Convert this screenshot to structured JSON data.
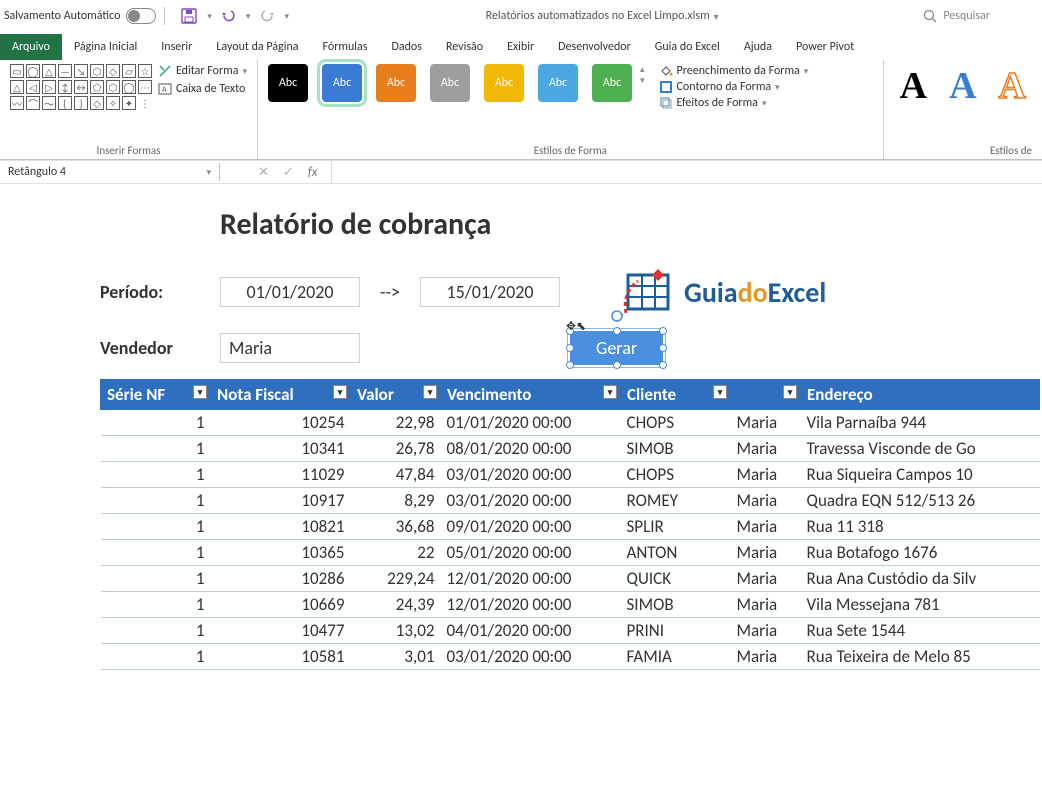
{
  "titlebar": {
    "autosave_label": "Salvamento Automático",
    "file_title": "Relatórios automatizados no Excel Limpo.xlsm",
    "search_placeholder": "Pesquisar"
  },
  "tabs": [
    "Arquivo",
    "Página Inicial",
    "Inserir",
    "Layout da Página",
    "Fórmulas",
    "Dados",
    "Revisão",
    "Exibir",
    "Desenvolvedor",
    "Guia do Excel",
    "Ajuda",
    "Power Pivot"
  ],
  "ribbon": {
    "shapes": {
      "edit_shape": "Editar Forma",
      "text_box": "Caixa de Texto",
      "group_label": "Inserir Formas"
    },
    "styles": {
      "swatch_text": "Abc",
      "fill": "Preenchimento da Forma",
      "outline": "Contorno da Forma",
      "effects": "Efeitos de Forma",
      "group_label": "Estilos de Forma"
    },
    "wordart": {
      "group_label": "Estilos de"
    }
  },
  "namebox": {
    "value": "Retângulo 4",
    "fx_label": "fx"
  },
  "report": {
    "title": "Relatório de cobrança",
    "period_label": "Período:",
    "period_from": "01/01/2020",
    "period_arrow": "-->",
    "period_to": "15/01/2020",
    "vendor_label": "Vendedor",
    "vendor_value": "Maria",
    "generate_btn": "Gerar"
  },
  "logo": {
    "p1": "Guia",
    "p2": "do",
    "p3": "Excel"
  },
  "table": {
    "headers": [
      "Série NF",
      "Nota Fiscal",
      "Valor",
      "Vencimento",
      "Cliente",
      "",
      "Endereço"
    ],
    "rows": [
      {
        "serie": "1",
        "nf": "10254",
        "valor": "22,98",
        "venc": "01/01/2020 00:00",
        "cli": "CHOPS",
        "vend": "Maria",
        "end": "Vila Parnaíba 944"
      },
      {
        "serie": "1",
        "nf": "10341",
        "valor": "26,78",
        "venc": "08/01/2020 00:00",
        "cli": "SIMOB",
        "vend": "Maria",
        "end": "Travessa Visconde de Go"
      },
      {
        "serie": "1",
        "nf": "11029",
        "valor": "47,84",
        "venc": "03/01/2020 00:00",
        "cli": "CHOPS",
        "vend": "Maria",
        "end": "Rua Siqueira Campos 10"
      },
      {
        "serie": "1",
        "nf": "10917",
        "valor": "8,29",
        "venc": "03/01/2020 00:00",
        "cli": "ROMEY",
        "vend": "Maria",
        "end": "Quadra EQN 512/513 26"
      },
      {
        "serie": "1",
        "nf": "10821",
        "valor": "36,68",
        "venc": "09/01/2020 00:00",
        "cli": "SPLIR",
        "vend": "Maria",
        "end": "Rua 11 318"
      },
      {
        "serie": "1",
        "nf": "10365",
        "valor": "22",
        "venc": "05/01/2020 00:00",
        "cli": "ANTON",
        "vend": "Maria",
        "end": "Rua Botafogo 1676"
      },
      {
        "serie": "1",
        "nf": "10286",
        "valor": "229,24",
        "venc": "12/01/2020 00:00",
        "cli": "QUICK",
        "vend": "Maria",
        "end": "Rua Ana Custódio da Silv"
      },
      {
        "serie": "1",
        "nf": "10669",
        "valor": "24,39",
        "venc": "12/01/2020 00:00",
        "cli": "SIMOB",
        "vend": "Maria",
        "end": "Vila Messejana 781"
      },
      {
        "serie": "1",
        "nf": "10477",
        "valor": "13,02",
        "venc": "04/01/2020 00:00",
        "cli": "PRINI",
        "vend": "Maria",
        "end": "Rua Sete 1544"
      },
      {
        "serie": "1",
        "nf": "10581",
        "valor": "3,01",
        "venc": "03/01/2020 00:00",
        "cli": "FAMIA",
        "vend": "Maria",
        "end": "Rua Teixeira de Melo 85"
      }
    ]
  }
}
